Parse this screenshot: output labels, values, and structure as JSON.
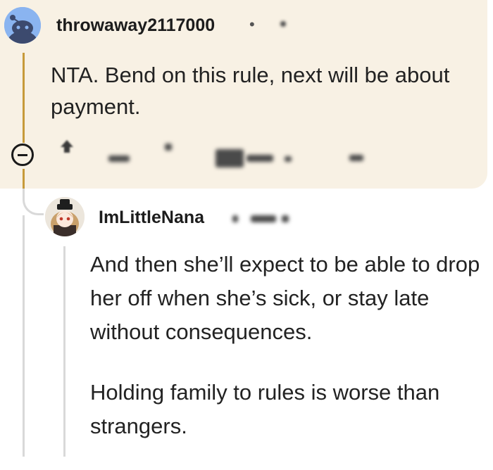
{
  "comment": {
    "username": "throwaway2117000",
    "separator": "•",
    "text": "NTA. Bend on this rule, next will be about payment.",
    "avatar_icon": "reddit-snoo-avatar",
    "collapse_icon": "collapse-minus-icon",
    "upvote_icon": "upvote-arrow-icon",
    "highlight_color": "#f8f1e4",
    "thread_color": "#c79a3a"
  },
  "reply": {
    "username": "ImLittleNana",
    "avatar_icon": "anime-girl-avatar",
    "paragraphs": [
      "And then she’ll expect to be able to drop her off when she’s sick, or stay late without consequences.",
      "Holding family to rules is worse than strangers."
    ]
  }
}
